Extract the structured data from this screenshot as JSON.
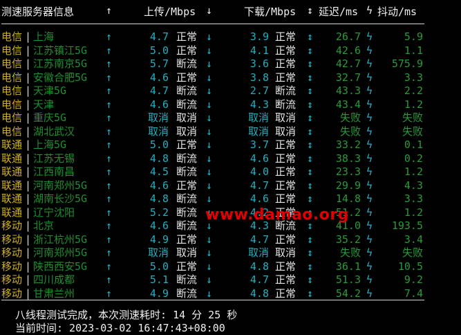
{
  "header": {
    "col_node": "测速服务器信息",
    "up_arrow": "↑",
    "col_upload": "上传/Mbps",
    "down_arrow": "↓",
    "col_download": "下载/Mbps",
    "updown_arrow": "↕",
    "col_latency": "延迟/ms",
    "bolt": "ϟ",
    "col_jitter": "抖动/ms"
  },
  "rows": [
    {
      "isp": "电信",
      "node": "上海",
      "up": "4.7",
      "up_status": "正常",
      "down": "3.9",
      "down_status": "正常",
      "latency": "26.7",
      "jitter": "5.9"
    },
    {
      "isp": "电信",
      "node": "江苏镇江5G",
      "up": "5.0",
      "up_status": "正常",
      "down": "4.1",
      "down_status": "正常",
      "latency": "42.6",
      "jitter": "1.1"
    },
    {
      "isp": "电信",
      "node": "江苏南京5G",
      "up": "5.7",
      "up_status": "断流",
      "down": "3.6",
      "down_status": "正常",
      "latency": "42.7",
      "jitter": "575.9"
    },
    {
      "isp": "电信",
      "node": "安徽合肥5G",
      "up": "4.6",
      "up_status": "正常",
      "down": "3.8",
      "down_status": "正常",
      "latency": "32.7",
      "jitter": "3.3"
    },
    {
      "isp": "电信",
      "node": "天津5G",
      "up": "4.7",
      "up_status": "断流",
      "down": "2.7",
      "down_status": "断流",
      "latency": "43.3",
      "jitter": "2.2"
    },
    {
      "isp": "电信",
      "node": "天津",
      "up": "4.6",
      "up_status": "断流",
      "down": "4.3",
      "down_status": "断流",
      "latency": "43.4",
      "jitter": "1.2"
    },
    {
      "isp": "电信",
      "node": "重庆5G",
      "up": "取消",
      "up_status": "取消",
      "down": "取消",
      "down_status": "取消",
      "latency": "失败",
      "jitter": "失败"
    },
    {
      "isp": "电信",
      "node": "湖北武汉",
      "up": "取消",
      "up_status": "取消",
      "down": "取消",
      "down_status": "取消",
      "latency": "失败",
      "jitter": "失败"
    },
    {
      "isp": "联通",
      "node": "上海5G",
      "up": "5.0",
      "up_status": "正常",
      "down": "3.7",
      "down_status": "正常",
      "latency": "33.2",
      "jitter": "0.1"
    },
    {
      "isp": "联通",
      "node": "江苏无锡",
      "up": "4.8",
      "up_status": "断流",
      "down": "4.6",
      "down_status": "正常",
      "latency": "38.3",
      "jitter": "0.2"
    },
    {
      "isp": "联通",
      "node": "江西南昌",
      "up": "4.5",
      "up_status": "断流",
      "down": "4.0",
      "down_status": "正常",
      "latency": "23.3",
      "jitter": "1.2"
    },
    {
      "isp": "联通",
      "node": "河南郑州5G",
      "up": "4.6",
      "up_status": "正常",
      "down": "4.7",
      "down_status": "正常",
      "latency": "29.9",
      "jitter": "4.3"
    },
    {
      "isp": "联通",
      "node": "湖南长沙5G",
      "up": "4.8",
      "up_status": "断流",
      "down": "4.6",
      "down_status": "正常",
      "latency": "14.8",
      "jitter": "3.3"
    },
    {
      "isp": "联通",
      "node": "辽宁沈阳",
      "up": "5.2",
      "up_status": "断流",
      "down": "4.2",
      "down_status": "正常",
      "latency": "51.2",
      "jitter": "1.2"
    },
    {
      "isp": "移动",
      "node": "北京",
      "up": "4.6",
      "up_status": "断流",
      "down": "4.3",
      "down_status": "断流",
      "latency": "41.0",
      "jitter": "193.5"
    },
    {
      "isp": "移动",
      "node": "浙江杭州5G",
      "up": "4.9",
      "up_status": "正常",
      "down": "4.7",
      "down_status": "正常",
      "latency": "35.2",
      "jitter": "3.4"
    },
    {
      "isp": "移动",
      "node": "河南郑州5G",
      "up": "取消",
      "up_status": "取消",
      "down": "取消",
      "down_status": "取消",
      "latency": "失败",
      "jitter": "失败"
    },
    {
      "isp": "移动",
      "node": "陕西西安5G",
      "up": "5.0",
      "up_status": "正常",
      "down": "4.8",
      "down_status": "正常",
      "latency": "36.1",
      "jitter": "10.5"
    },
    {
      "isp": "移动",
      "node": "四川成都",
      "up": "5.1",
      "up_status": "断流",
      "down": "4.7",
      "down_status": "正常",
      "latency": "51.3",
      "jitter": "9.2"
    },
    {
      "isp": "移动",
      "node": "甘肃兰州",
      "up": "4.9",
      "up_status": "断流",
      "down": "4.8",
      "down_status": "正常",
      "latency": "54.2",
      "jitter": "7.4"
    }
  ],
  "row_symbols": {
    "bar": "|",
    "up_arrow": "↑",
    "down_arrow": "↓",
    "updown_arrow": "↕",
    "bolt": "ϟ"
  },
  "footer": {
    "summary": "八线程测试完成，本次测速耗时: 14 分 25 秒",
    "time_line": "当前时间: 2023-03-02 16:47:43+08:00"
  },
  "watermark": "www.damao.org"
}
